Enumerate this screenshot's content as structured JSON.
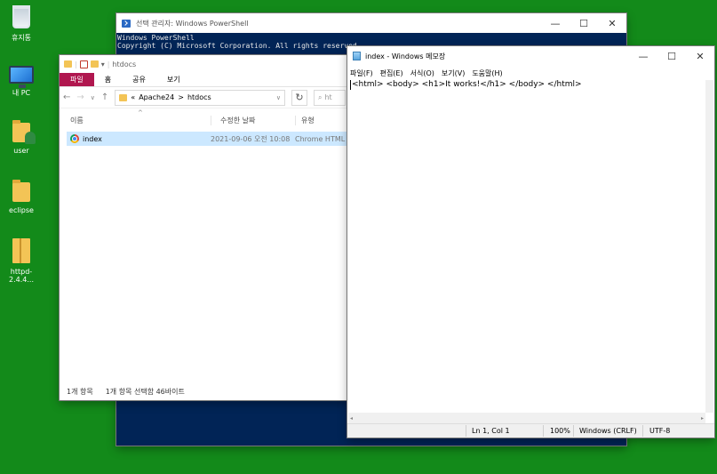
{
  "desktop": {
    "icons": [
      {
        "label": "휴지통",
        "icon": "recycle-bin-icon"
      },
      {
        "label": "내 PC",
        "icon": "this-pc-icon"
      },
      {
        "label": "user",
        "icon": "user-folder-icon"
      },
      {
        "label": "eclipse",
        "icon": "folder-icon"
      },
      {
        "label": "httpd-2.4.4...",
        "icon": "zip-folder-icon"
      }
    ]
  },
  "powershell": {
    "title": "선택 관리자: Windows PowerShell",
    "lines": [
      "Windows PowerShell",
      "Copyright (C) Microsoft Corporation. All rights reserved."
    ]
  },
  "explorer": {
    "title": "htdocs",
    "ribbon": {
      "file": "파일",
      "home": "홈",
      "share": "공유",
      "view": "보기"
    },
    "address": {
      "parent": "Apache24",
      "current": "htdocs",
      "sep1": "«",
      "sep2": ">"
    },
    "search_placeholder": "ht",
    "columns": {
      "name": "이름",
      "date": "수정한 날짜",
      "type": "유형"
    },
    "rows": [
      {
        "name": "index",
        "date": "2021-09-06 오전 10:08",
        "type": "Chrome HTML"
      }
    ],
    "status": {
      "count": "1개 항목",
      "selected": "1개 항목 선택함 46바이트"
    }
  },
  "notepad": {
    "title": "index - Windows 메모장",
    "menu": [
      "파일(F)",
      "편집(E)",
      "서식(O)",
      "보기(V)",
      "도움말(H)"
    ],
    "content": "<html> <body> <h1>It works!</h1> </body> </html>",
    "status": {
      "position": "Ln 1, Col 1",
      "zoom": "100%",
      "line_ending": "Windows (CRLF)",
      "encoding": "UTF-8"
    }
  }
}
